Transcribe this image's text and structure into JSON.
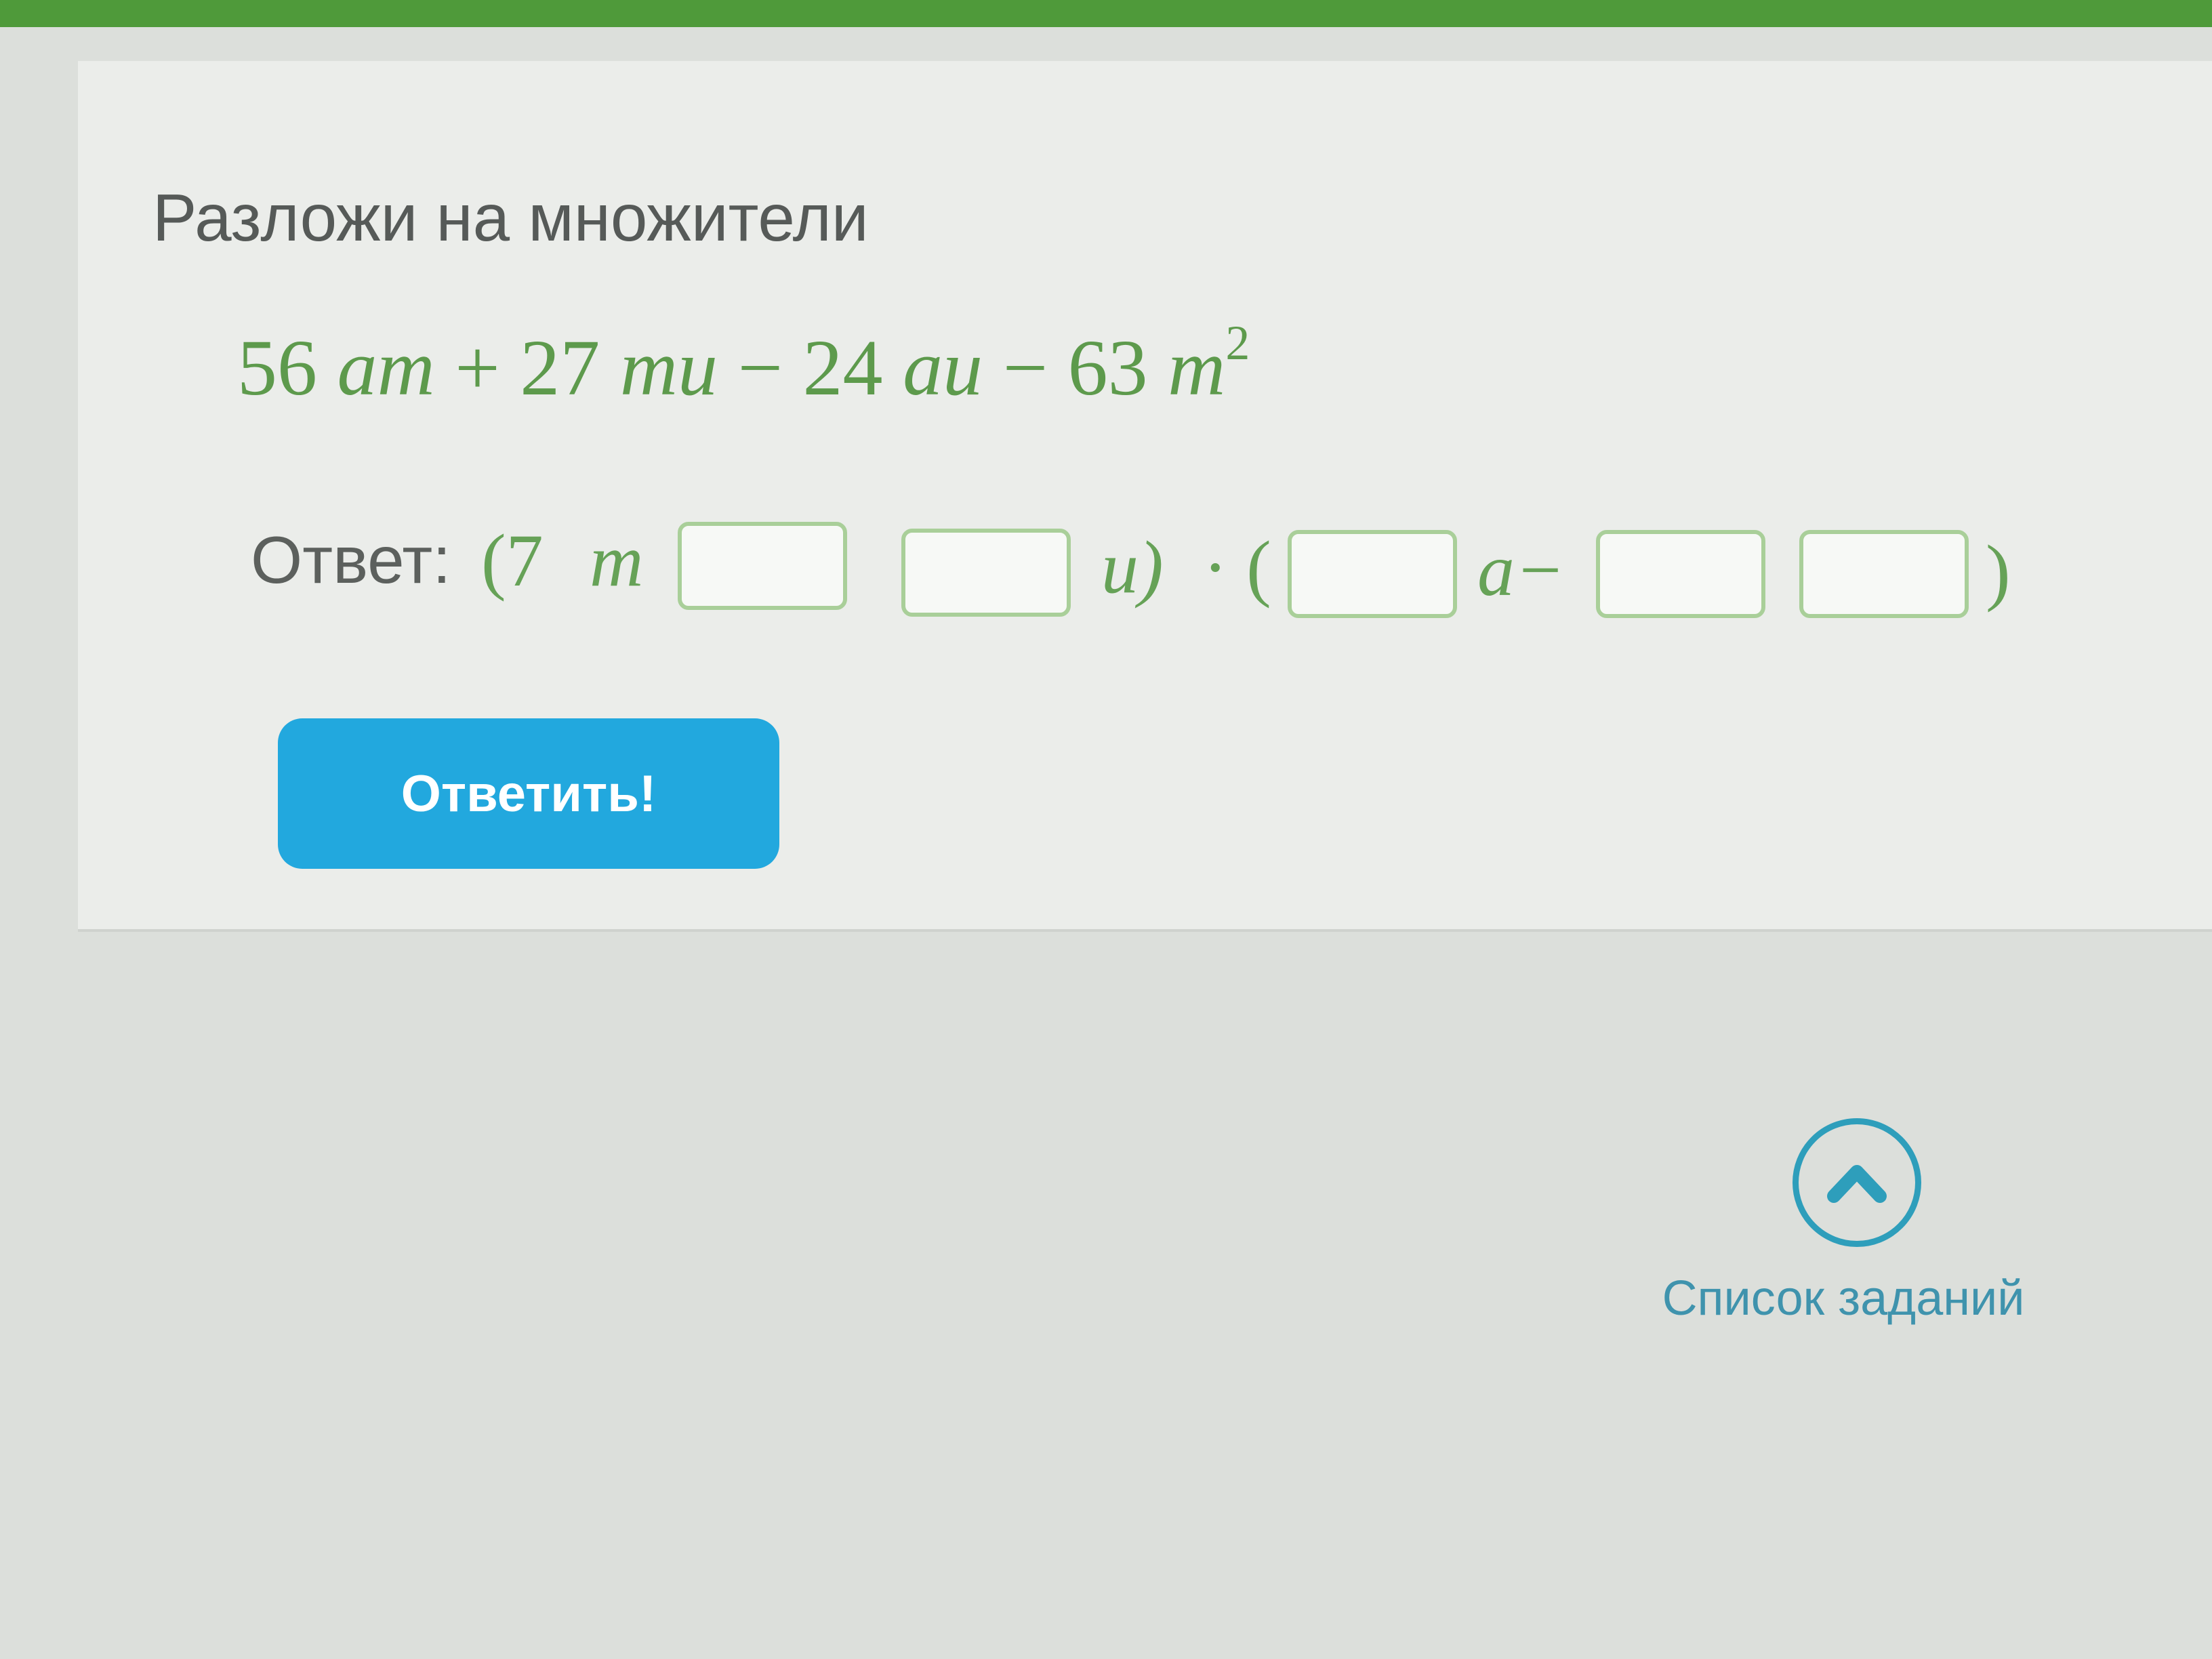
{
  "task": {
    "instruction": "Разложи на множители",
    "expression": {
      "t1_coef": "56 ",
      "t1_var": "am",
      "op1": " + 27 ",
      "t2_var": "mu",
      "op2": " − 24 ",
      "t3_var": "au",
      "op3": " − 63 ",
      "t4_var": "m",
      "t4_exp": "2"
    }
  },
  "answer": {
    "label": "Ответ:",
    "open_paren_seven": "(7",
    "var_m": "m",
    "var_u_close": "u)",
    "dot_open": "· (",
    "var_a_minus": "a−",
    "close_paren": ")",
    "inputs": [
      "",
      "",
      "",
      "",
      ""
    ]
  },
  "submit": {
    "label": "Ответить!"
  },
  "task_list": {
    "label": "Список заданий",
    "icon": "chevron-up-icon"
  },
  "colors": {
    "header_green": "#4f9a3a",
    "math_green": "#5d9a4c",
    "button_blue": "#22a8de",
    "link_teal": "#2e9ebb"
  }
}
